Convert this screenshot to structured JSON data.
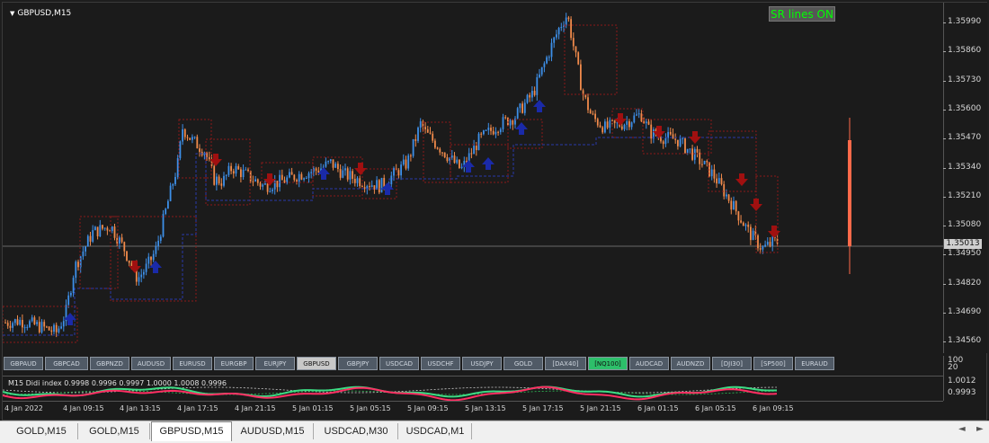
{
  "chart": {
    "symbol_title": "GBPUSD,M15",
    "sr_toggle_label": "SR lines ON",
    "current_price": "1.35013",
    "price_ticks": [
      "1.35990",
      "1.35860",
      "1.35730",
      "1.35600",
      "1.35470",
      "1.35340",
      "1.35210",
      "1.35080",
      "1.34950",
      "1.34820",
      "1.34690",
      "1.34560"
    ],
    "indicator_label": "M15 Didi index 0.9998 0.9996 0.9997 1.0000 1.0008 0.9996",
    "indicator_ticks": [
      "100",
      "20",
      "1.0012",
      "0.9993"
    ],
    "time_ticks": [
      "4 Jan 2022",
      "4 Jan 09:15",
      "4 Jan 13:15",
      "4 Jan 17:15",
      "4 Jan 21:15",
      "5 Jan 01:15",
      "5 Jan 05:15",
      "5 Jan 09:15",
      "5 Jan 13:15",
      "5 Jan 17:15",
      "5 Jan 21:15",
      "6 Jan 01:15",
      "6 Jan 05:15",
      "6 Jan 09:15"
    ],
    "colors": {
      "bull": "#3d8fe8",
      "bear": "#f08a4b",
      "up_arrow": "#1a2aa8",
      "down_arrow": "#a01010",
      "sr_line": "#8b1a1a",
      "support_line": "#2a3aa8",
      "indicator_green": "#3ddc84",
      "indicator_red": "#ff2e63"
    }
  },
  "symbol_buttons": [
    "GBPAUD",
    "GBPCAD",
    "GBPNZD",
    "AUDUSD",
    "EURUSD",
    "EURGBP",
    "EURJPY",
    "GBPUSD",
    "GBPJPY",
    "USDCAD",
    "USDCHF",
    "USDJPY",
    "GOLD",
    "[DAX40]",
    "[NQ100]",
    "AUDCAD",
    "AUDNZD",
    "[DJI30]",
    "[SP500]",
    "EURAUD"
  ],
  "active_symbol": "GBPUSD",
  "highlighted_symbol": "[NQ100]",
  "tabs": [
    "GOLD,M15",
    "GOLD,M15",
    "GBPUSD,M15",
    "AUDUSD,M15",
    "USDCAD,M30",
    "USDCAD,M1"
  ],
  "active_tab": "GBPUSD,M15",
  "scroll_icons": [
    "arrow-left",
    "arrow-right"
  ]
}
